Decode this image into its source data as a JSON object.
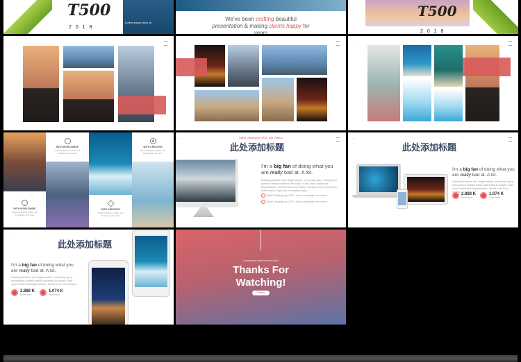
{
  "top_row": {
    "left_logo": "T500",
    "left_year": "2 0 1 8",
    "left_red_text": "Lorem ipsum dolor sit",
    "middle_text_before": "We've been ",
    "middle_word1": "crafting",
    "middle_text_mid": " beautiful",
    "middle_word2": "presentation",
    "middle_text_mid2": " & making ",
    "middle_word3": "clients",
    "middle_word4": "happy",
    "middle_text_after": " for",
    "middle_years": "years",
    "right_logo": "T500",
    "right_year": "2 0 1 8"
  },
  "slide4": {
    "items": [
      {
        "title": "WITH WORLDWIDE",
        "desc": "Spelit Displaying 100G. sub knowledge info other"
      },
      {
        "title": "WITH CREATIVE",
        "desc": "Spelit Displaying 100G. sub knowledge info other"
      },
      {
        "title": "WITH WORLDWIDE",
        "desc": "Spelit Displaying 100G. sub knowledge info other"
      },
      {
        "title": "WITH CREATIVE",
        "desc": "Spelit Displaying 100G. sub knowledge info other"
      }
    ]
  },
  "slide5": {
    "overline": "Spelit Displaying 100G. sub Vendor",
    "title": "此处添加标题",
    "lead_a": "I'm a ",
    "lead_b": "big fan",
    "lead_c": " of doing what you are ",
    "lead_d": "really",
    "lead_e": " bad at. A lot.",
    "body": "Hashtag fashion axe fingerstache, everyday carry, stumptown pickled seitan authentic brooklyn. Kale chips hammock fingerstache, beard trust fund selfies. Sriracha retro normcore, small batch kogi wolf, everyday carry.",
    "bullet1": "Spelit Displaying 100G. sub knowledge info other",
    "bullet2": "Spelit Displaying 100G. sub knowledge info other"
  },
  "slide6": {
    "title": "此处添加标题",
    "lead_a": "I'm a ",
    "lead_b": "big fan",
    "lead_c": " of doing what you are ",
    "lead_d": "really",
    "lead_e": " bad at. A lot.",
    "body": "Hashtag fashion axe fingerstache, everyday carry, stumptown pickled seitan authentic brooklyn. Kale chips hammock fingerstache, beard trust fund selfies.",
    "stat1_value": "2.888 K",
    "stat1_label": "Email sent",
    "stat2_value": "1.074 K",
    "stat2_label": "Team bold"
  },
  "slide7": {
    "title": "此处添加标题",
    "lead_a": "I'm a ",
    "lead_b": "big fan",
    "lead_c": " of doing what you are ",
    "lead_d": "really",
    "lead_e": " bad at. A lot.",
    "body": "Hashtag fashion axe fingerstache, everyday carry, stumptown pickled seitan authentic brooklyn. Kale chips hammock fingerstache, beard trust fund selfies.",
    "stat1_value": "2.888 K",
    "stat1_label": "Email sent",
    "stat2_value": "1.074 K",
    "stat2_label": "Team bold"
  },
  "slide8": {
    "overline": "Loremipsum state find tram build",
    "thanks_line1": "Thanks For",
    "thanks_line2": "Watching!",
    "button": "Thanks"
  },
  "colors": {
    "accent_red": "#d75b5b",
    "title_blue": "#3b4a63",
    "thanks_grad_top": "#d9646a",
    "thanks_grad_bottom": "#5d73a6"
  },
  "icons": [
    "gear-icon",
    "shield-icon",
    "compass-icon",
    "cube-icon",
    "menu-icon"
  ]
}
